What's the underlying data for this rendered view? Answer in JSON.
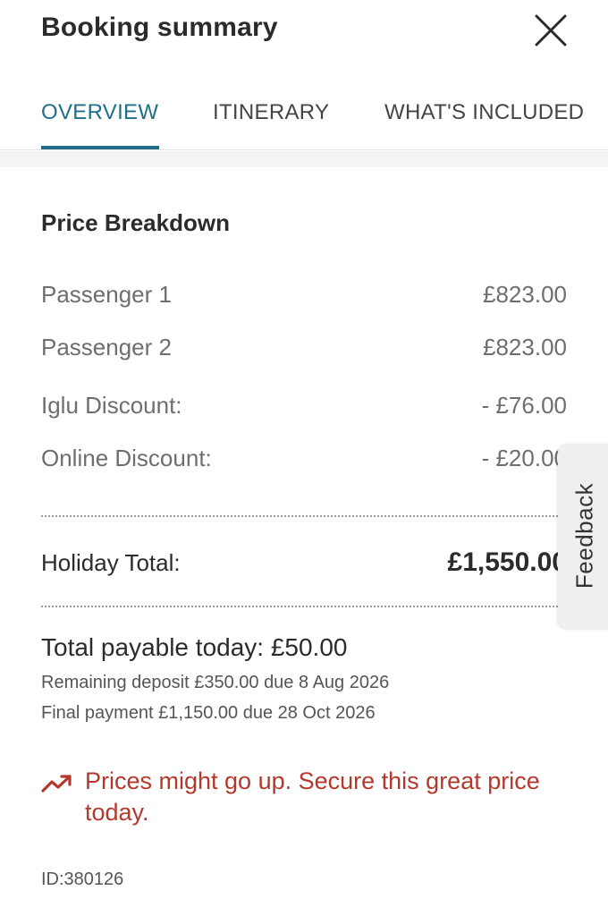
{
  "header": {
    "title": "Booking summary",
    "close_icon": "close-icon"
  },
  "tabs": [
    {
      "label": "OVERVIEW",
      "active": true
    },
    {
      "label": "ITINERARY",
      "active": false
    },
    {
      "label": "WHAT'S INCLUDED",
      "active": false
    }
  ],
  "breakdown": {
    "title": "Price Breakdown",
    "rows": [
      {
        "label": "Passenger 1",
        "value": "£823.00"
      },
      {
        "label": "Passenger 2",
        "value": "£823.00"
      },
      {
        "label": "Iglu Discount:",
        "value": "- £76.00"
      },
      {
        "label": "Online Discount:",
        "value": "- £20.00"
      }
    ]
  },
  "total": {
    "label": "Holiday Total:",
    "value": "£1,550.00"
  },
  "payment": {
    "payable": "Total payable today: £50.00",
    "deposit": "Remaining deposit £350.00 due 8 Aug 2026",
    "final": "Final payment £1,150.00 due 28 Oct 2026"
  },
  "warning": {
    "text": "Prices might go up. Secure this great price today.",
    "icon": "trending-up-icon"
  },
  "booking_id": "ID:380126",
  "feedback": {
    "label": "Feedback"
  },
  "colors": {
    "accent": "#1f6f8b",
    "warning": "#b5382d"
  }
}
